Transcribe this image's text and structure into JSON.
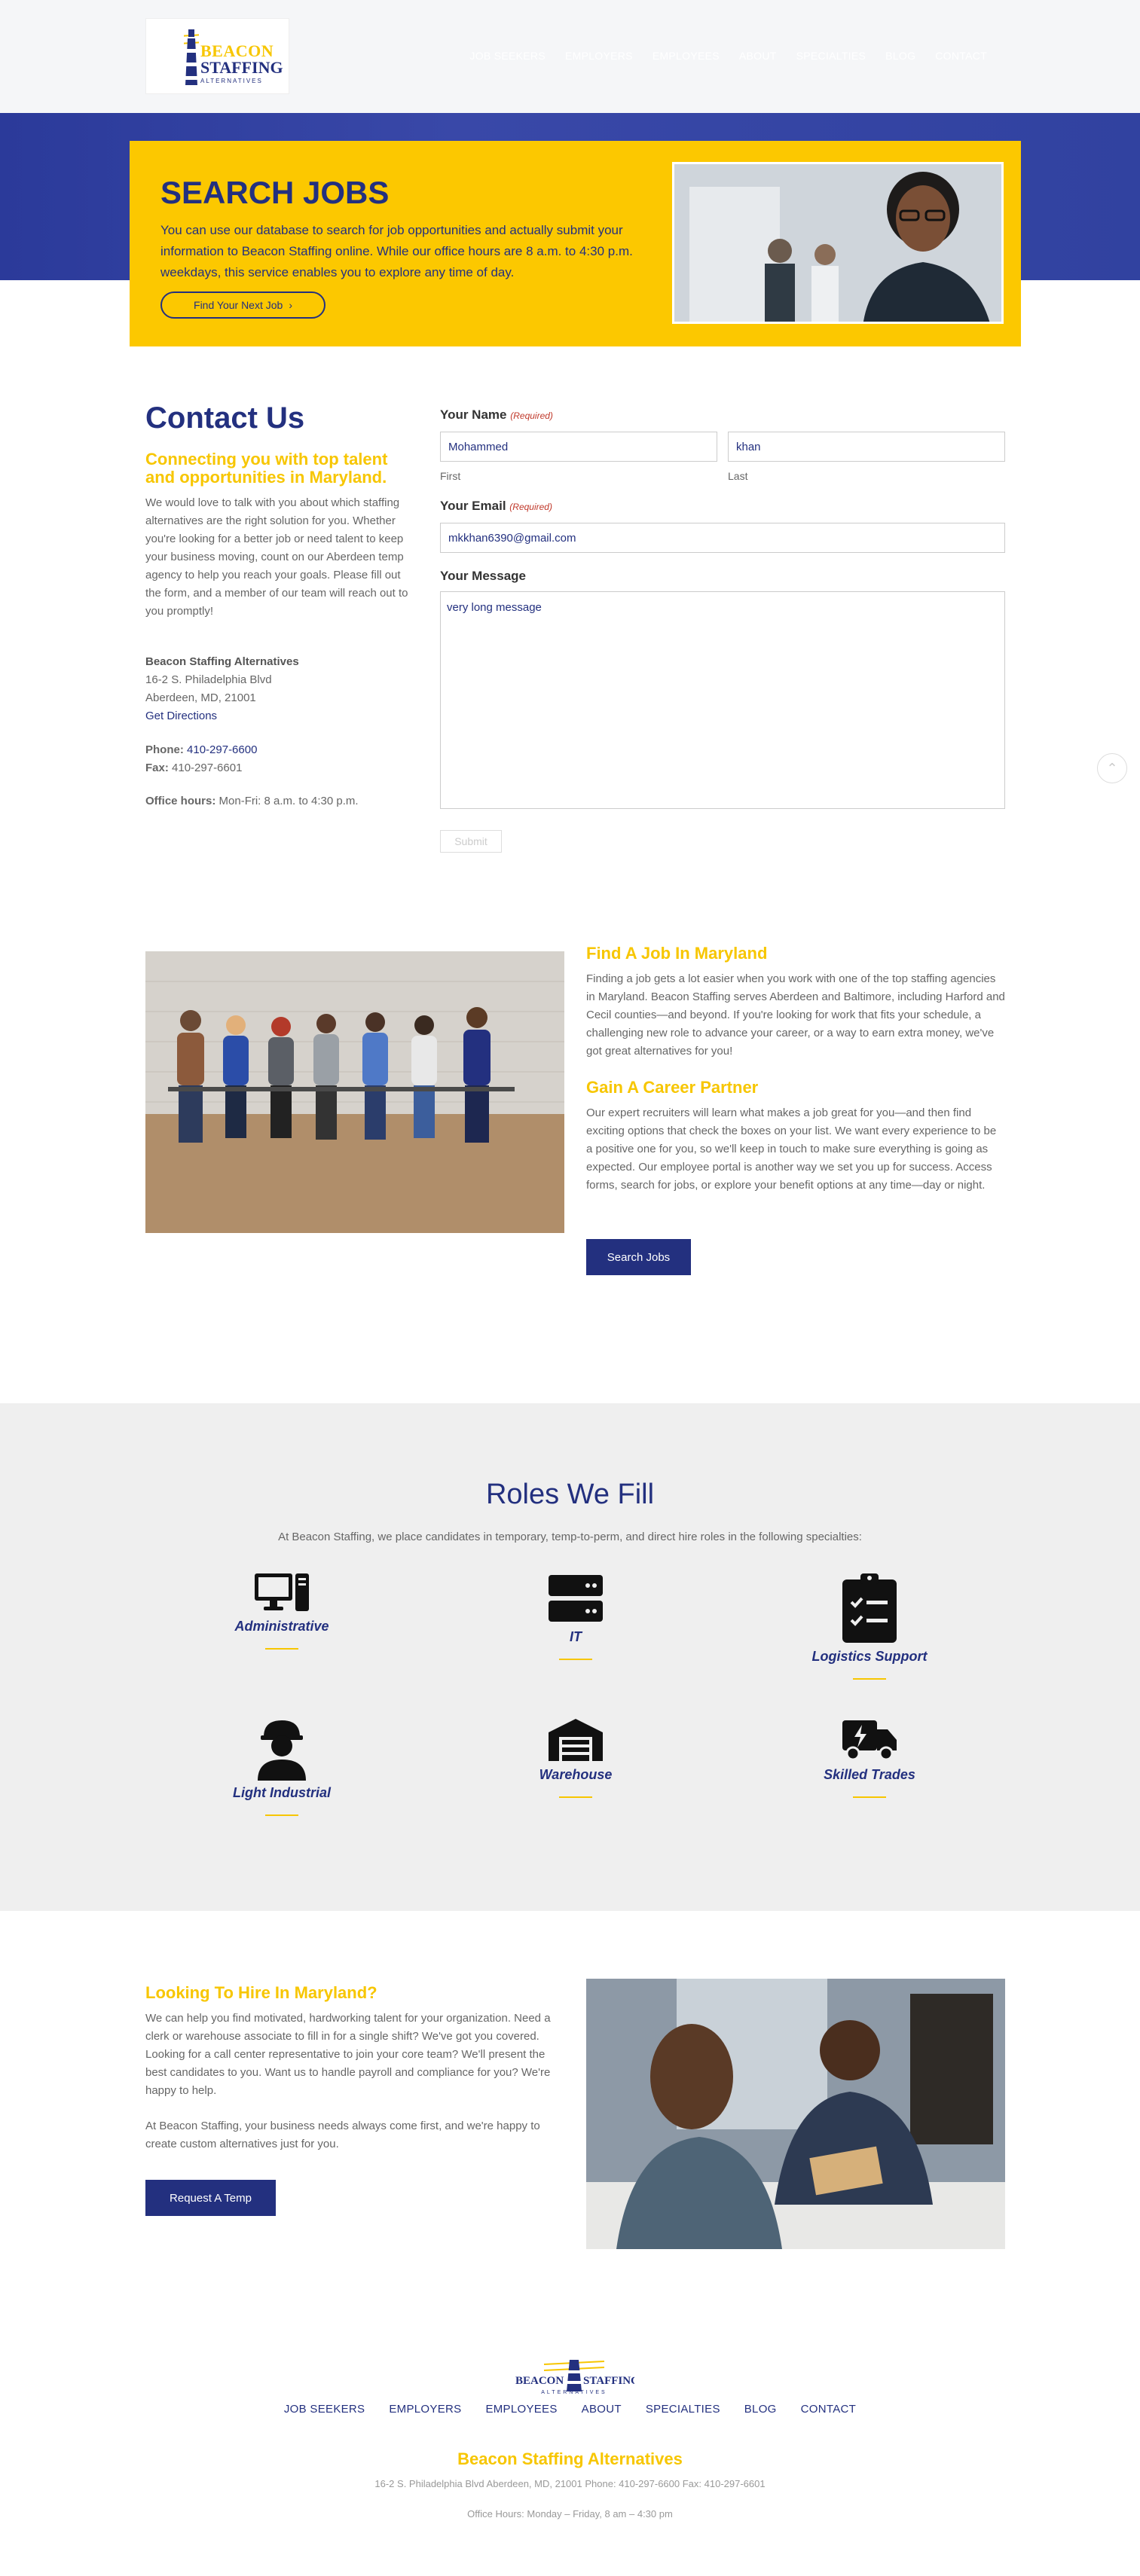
{
  "header": {
    "logo": {
      "line1": "BEACON",
      "line2": "STAFFING",
      "line3": "ALTERNATIVES"
    },
    "nav": [
      "JOB SEEKERS",
      "EMPLOYERS",
      "EMPLOYEES",
      "ABOUT",
      "SPECIALTIES",
      "BLOG",
      "CONTACT"
    ]
  },
  "hero": {
    "title": "SEARCH JOBS",
    "text": "You can use our database to search for job opportunities and actually submit your information to Beacon Staffing online. While our office hours are 8 a.m. to 4:30 p.m. weekdays, this service enables you to explore any time of day.",
    "button": "Find Your Next Job"
  },
  "contact": {
    "title": "Contact Us",
    "subtitle": "Connecting you with top talent and opportunities in Maryland.",
    "body": "We would love to talk with you about which staffing alternatives are the right solution for you. Whether you're looking for a better job or need talent to keep your business moving, count on our Aberdeen temp agency to help you reach your goals. Please fill out the form, and a member of our team will reach out to you promptly!",
    "company": "Beacon Staffing Alternatives",
    "street": "16-2 S. Philadelphia Blvd",
    "city": "Aberdeen, MD, 21001",
    "directions": "Get Directions",
    "phone_label": "Phone:",
    "phone": "410-297-6600",
    "fax_label": "Fax:",
    "fax": "410-297-6601",
    "hours_label": "Office hours:",
    "hours": "Mon-Fri: 8 a.m. to 4:30 p.m."
  },
  "form": {
    "name_label": "Your Name",
    "required": "(Required)",
    "first_value": "Mohammed",
    "last_value": "khan",
    "first_label": "First",
    "last_label": "Last",
    "email_label": "Your Email",
    "email_value": "mkkhan6390@gmail.com",
    "message_label": "Your Message",
    "message_value": "very long message",
    "submit": "Submit"
  },
  "jobs": {
    "heading1": "Find A Job In Maryland",
    "text1": "Finding a job gets a lot easier when you work with one of the top staffing agencies in Maryland. Beacon Staffing serves Aberdeen and Baltimore, including Harford and Cecil counties—and beyond. If you're looking for work that fits your schedule, a challenging new role to advance your career, or a way to earn extra money, we've got great alternatives for you!",
    "heading2": "Gain A Career Partner",
    "text2": "Our expert recruiters will learn what makes a job great for you—and then find exciting options that check the boxes on your list. We want every experience to be a positive one for you, so we'll keep in touch to make sure everything is going as expected. Our employee portal is another way we set you up for success. Access forms, search for jobs, or explore your benefit options at any time—day or night.",
    "button": "Search Jobs"
  },
  "roles": {
    "title": "Roles We Fill",
    "subtitle": "At Beacon Staffing, we place candidates in temporary, temp-to-perm, and direct hire roles in the following specialties:",
    "items": [
      {
        "name": "Administrative",
        "icon": "desktop-icon"
      },
      {
        "name": "IT",
        "icon": "server-icon"
      },
      {
        "name": "Logistics Support",
        "icon": "clipboard-check-icon"
      },
      {
        "name": "Light Industrial",
        "icon": "hard-hat-worker-icon"
      },
      {
        "name": "Warehouse",
        "icon": "warehouse-icon"
      },
      {
        "name": "Skilled Trades",
        "icon": "truck-bolt-icon"
      }
    ]
  },
  "hire": {
    "heading": "Looking To Hire In Maryland?",
    "text1": "We can help you find motivated, hardworking talent for your organization. Need a clerk or warehouse associate to fill in for a single shift? We've got you covered. Looking for a call center representative to join your core team? We'll present the best candidates to you. Want us to handle payroll and compliance for you? We're happy to help.",
    "text2": "At Beacon Staffing, your business needs always come first, and we're happy to create custom alternatives just for you.",
    "button": "Request A Temp"
  },
  "footer": {
    "logo": {
      "line1": "BEACON",
      "line2": "STAFFING",
      "line3": "ALTERNATIVES"
    },
    "nav": [
      "JOB SEEKERS",
      "EMPLOYERS",
      "EMPLOYEES",
      "ABOUT",
      "SPECIALTIES",
      "BLOG",
      "CONTACT"
    ],
    "name": "Beacon Staffing Alternatives",
    "address": "16-2 S. Philadelphia Blvd Aberdeen, MD, 21001 Phone: 410-297-6600 Fax: 410-297-6601",
    "hours": "Office Hours: Monday – Friday, 8 am – 4:30 pm"
  },
  "colors": {
    "navy": "#23307f",
    "yellow": "#fcc800",
    "gold_text": "#f7c600"
  }
}
